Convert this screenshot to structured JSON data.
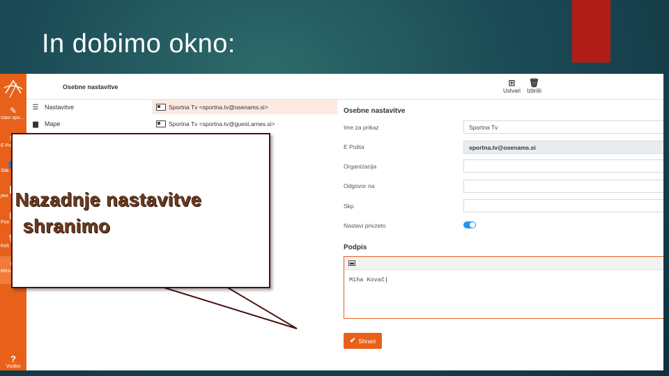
{
  "slide": {
    "title": "In dobimo okno:",
    "accent_color": "#b01c18"
  },
  "rail": {
    "color": "#e8611a",
    "items": [
      {
        "icon": "edit-icon",
        "label": "stavi spo..."
      },
      {
        "icon": "mail-icon",
        "label": "E Po"
      },
      {
        "icon": "users-icon",
        "label": "Stik"
      },
      {
        "icon": "folder-icon",
        "label": "javi"
      },
      {
        "icon": "calendar-icon",
        "label": "Pon"
      },
      {
        "icon": "trash-icon",
        "label": "Koš"
      },
      {
        "icon": "gear-icon",
        "label": "ebra"
      }
    ],
    "help_label": "Vizitko",
    "help_icon": "?"
  },
  "middle": {
    "header": "Osebne nastavitve",
    "menu": [
      {
        "icon": "list-icon",
        "label": "Nastavitve"
      },
      {
        "icon": "folder-icon",
        "label": "Mape"
      }
    ],
    "accounts": [
      "Sportna Tv <sportna.tv@osenams.si>",
      "Sportna Tv <sportna.tv@guest.arnes.si>"
    ]
  },
  "toolbar": {
    "create_label": "Ustvari",
    "delete_label": "Izbriši"
  },
  "form": {
    "title": "Osebne nastavitve",
    "fields": [
      {
        "label": "Ime za prikaz",
        "value": "Sportna Tv"
      },
      {
        "label": "E Pošta",
        "value": "sportna.tv@osenams.si"
      },
      {
        "label": "Organizacija",
        "value": ""
      },
      {
        "label": "Odgovor na",
        "value": ""
      },
      {
        "label": "Skp",
        "value": ""
      }
    ],
    "default_label": "Nastavi privzeto",
    "default_on": true,
    "signature_title": "Podpis",
    "signature_text": "Miha Kovač",
    "save_label": "Shrani"
  },
  "callout": {
    "line1": "Nazadnje nastavitve",
    "line2": "shranimo"
  }
}
